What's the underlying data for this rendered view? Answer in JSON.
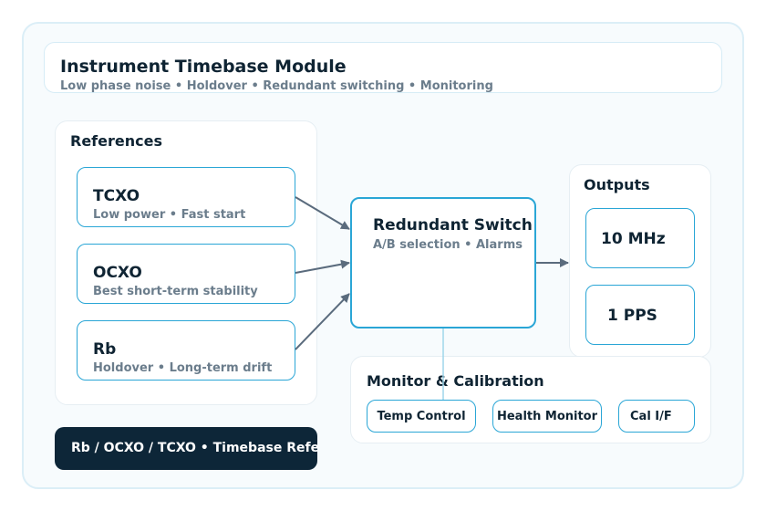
{
  "header": {
    "title": "Instrument Timebase Module",
    "subtitle": "Low phase noise • Holdover • Redundant switching • Monitoring"
  },
  "references": {
    "title": "References",
    "items": [
      {
        "name": "TCXO",
        "detail": "Low power • Fast start"
      },
      {
        "name": "OCXO",
        "detail": "Best short-term stability"
      },
      {
        "name": "Rb",
        "detail": "Holdover • Long-term drift"
      }
    ]
  },
  "switch": {
    "title": "Redundant Switch",
    "detail": "A/B selection • Alarms"
  },
  "outputs": {
    "title": "Outputs",
    "items": [
      "10 MHz",
      "1 PPS"
    ]
  },
  "monitor": {
    "title": "Monitor & Calibration",
    "items": [
      "Temp Control",
      "Health Monitor",
      "Cal I/F"
    ]
  },
  "banner": {
    "text": "Rb / OCXO / TCXO • Timebase Reference"
  },
  "colors": {
    "accent": "#2aa6d6",
    "banner_bg": "#0d2638",
    "arrow": "#5a6b7d"
  }
}
